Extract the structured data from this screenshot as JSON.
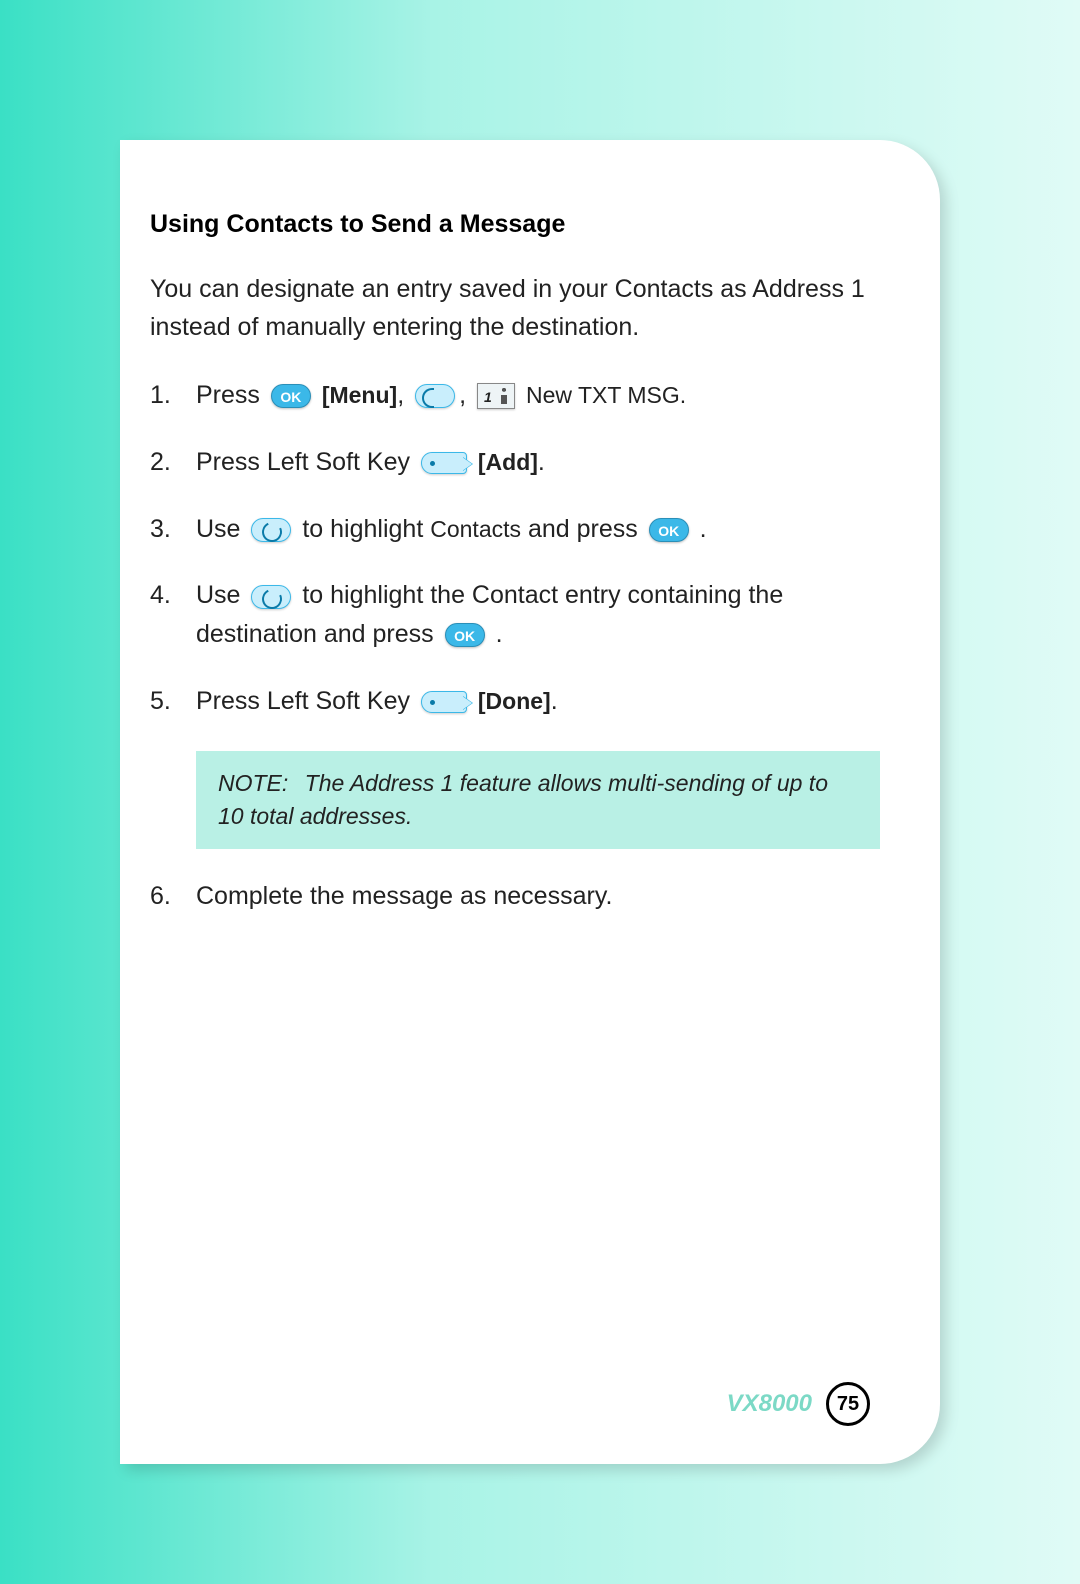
{
  "heading": "Using Contacts to Send a Message",
  "intro": "You can designate an entry saved in your Contacts as Address 1 instead of manually entering the destination.",
  "icons": {
    "ok": "OK",
    "key1": "1"
  },
  "steps": {
    "s1": {
      "press": "Press ",
      "menu": "[Menu]",
      "newtxt": "New TXT MSG."
    },
    "s2": {
      "press": "Press Left Soft Key ",
      "add": "[Add]"
    },
    "s3": {
      "use": "Use ",
      "mid": " to highlight ",
      "contacts": "Contacts",
      "andpress": " and press "
    },
    "s4": {
      "use": "Use ",
      "mid": " to highlight the Contact entry containing the destination and press "
    },
    "s5": {
      "press": "Press  Left Soft Key ",
      "done": "[Done]"
    },
    "s6": "Complete the message as necessary."
  },
  "note": {
    "label": "NOTE:",
    "text": "The Address 1 feature allows multi-sending of up to 10 total addresses."
  },
  "footer": {
    "model": "VX8000",
    "page": "75"
  },
  "punct": {
    "comma": ",",
    "period": ".",
    "commasp": ", "
  }
}
